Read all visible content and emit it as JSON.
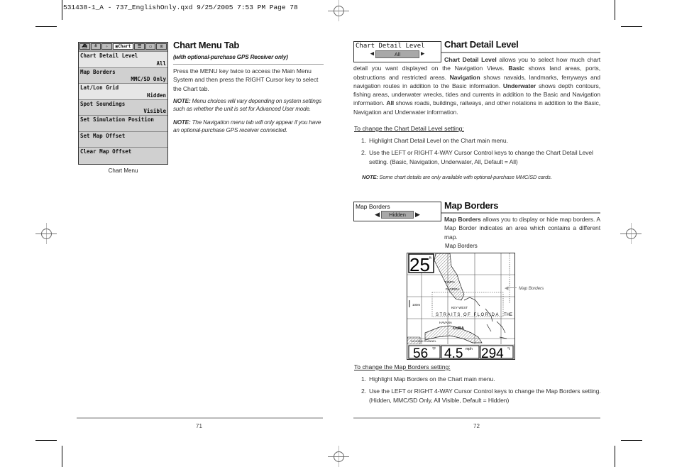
{
  "slug": "531438-1_A - 737_EnglishOnly.qxd  9/25/2005  7:53 PM  Page 78",
  "left_page": {
    "chart_menu": {
      "tabs": [
        "nav-icon",
        "sonar-icon",
        "setup-icon",
        "Chart",
        "alarms-icon",
        "views-icon",
        "accessories-icon"
      ],
      "active_tab": "Chart",
      "items": [
        {
          "label": "Chart Detail Level",
          "value": "All"
        },
        {
          "label": "Map Borders",
          "value": "MMC/SD Only"
        },
        {
          "label": "Lat/Lon Grid",
          "value": "Hidden"
        },
        {
          "label": "Spot Soundings",
          "value": "Visible"
        },
        {
          "label": "Set Simulation Position",
          "value": ""
        },
        {
          "label": "Set Map Offset",
          "value": ""
        },
        {
          "label": "Clear Map Offset",
          "value": ""
        }
      ],
      "caption": "Chart Menu"
    },
    "title": "Chart Menu Tab",
    "subtitle": "(with optional-purchase GPS Receiver only)",
    "body": "Press the MENU key twice to access the Main Menu System and then press the RIGHT Cursor key to select the Chart tab.",
    "note1_label": "NOTE:",
    "note1": " Menu choices will vary depending on system settings such as whether the unit is set for Advanced User mode.",
    "note2_label": "NOTE:",
    "note2": " The Navigation menu tab will only appear if you have an optional-purchase GPS receiver connected.",
    "page_number": "71"
  },
  "right_page": {
    "detail_setting": {
      "label": "Chart Detail Level",
      "value": "All"
    },
    "detail_title": "Chart Detail Level",
    "detail_body": {
      "p1_bold": "Chart Detail Level",
      "p1": " allows you to select how much chart detail you want displayed on the Navigation Views. ",
      "basic_bold": "Basic",
      "basic": " shows land areas, ports, obstructions and restricted areas. ",
      "nav_bold": "Navigation",
      "nav": " shows navaids, landmarks, ferryways and navigation routes in addition to the Basic information. ",
      "uw_bold": "Underwater",
      "uw": " shows depth contours, fishing areas, underwater wrecks, tides and currents in addition to the Basic and Navigation information. ",
      "all_bold": "All",
      "all": " shows roads, buildings, railways, and other notations in addition to the Basic, Navigation and Underwater information."
    },
    "detail_howto": "To change the Chart Detail Level setting:",
    "detail_steps": [
      "Highlight Chart Detail Level on the Chart main menu.",
      "Use the LEFT or RIGHT 4-WAY Cursor Control keys to change the Chart Detail Level setting. (Basic, Navigation, Underwater, All, Default = All)"
    ],
    "detail_note_label": "NOTE:",
    "detail_note": " Some chart details are only available with optional-purchase MMC/SD cards.",
    "borders_setting": {
      "label": "Map Borders",
      "value": "Hidden"
    },
    "borders_title": "Map Borders",
    "borders_body_bold": "Map Borders",
    "borders_body": " allows you to display or hide map borders. A Map Border indicates an area which contains a different map.",
    "figure_caption": "Map Borders",
    "figure_callout": "Map Borders",
    "map": {
      "depth": "25",
      "depth_unit": "ft",
      "scale": "100m",
      "labels": [
        "STRAITS OF FLORIDA",
        "THE",
        "CUBA",
        "HAVANA",
        "KEY WEST",
        "TAMPA",
        "FLORIDA",
        "YUCATAN CHANNEL"
      ],
      "temp": "56",
      "temp_unit": "°F",
      "speed": "4.5",
      "speed_unit": "mph",
      "heading": "294",
      "heading_unit": "°t"
    },
    "borders_howto": "To change the Map Borders setting:",
    "borders_steps": [
      "Highlight Map Borders on the Chart main menu.",
      "Use the LEFT or RIGHT 4-WAY Cursor Control keys to change the Map Borders setting. (Hidden, MMC/SD Only, All Visible, Default = Hidden)"
    ],
    "page_number": "72"
  }
}
